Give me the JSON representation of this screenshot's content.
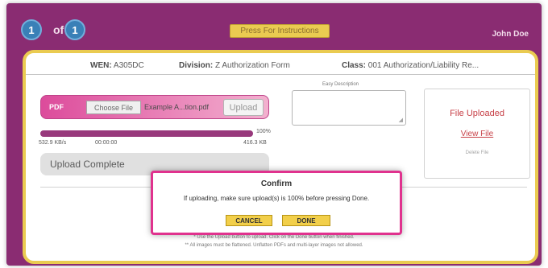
{
  "header": {
    "page_current": "1",
    "page_of": "of",
    "page_total": "1",
    "instructions_label": "Press For Instructions",
    "user_name": "John Doe"
  },
  "info_bar": {
    "wen_label": "WEN:",
    "wen_value": "A305DC",
    "division_label": "Division:",
    "division_value": "Z Authorization Form",
    "class_label": "Class:",
    "class_value": "001 Authorization/Liability Re..."
  },
  "upload": {
    "type_label": "PDF",
    "choose_label": "Choose File",
    "file_name": "Example A...tion.pdf",
    "upload_label": "Upload",
    "progress_percent": 100,
    "percent_text": "100%",
    "speed_text": "532.9 KB/s",
    "elapsed_text": "00:00:00",
    "size_text": "416.3 KB",
    "complete_text": "Upload Complete"
  },
  "description": {
    "label": "Easy Description"
  },
  "status": {
    "uploaded_text": "File Uploaded",
    "view_link": "View File",
    "delete_link": "Delete File"
  },
  "footer": {
    "note1": "* Use the Upload button to upload. Click on the Done button when finished.",
    "note2": "** All images must be flattened. Unflatten PDFs and multi-layer images not allowed."
  },
  "dialog": {
    "title": "Confirm",
    "message": "If uploading, make sure upload(s) is 100% before pressing Done.",
    "cancel_label": "CANCEL",
    "done_label": "DONE"
  },
  "colors": {
    "frame": "#7a0f5f",
    "accent_gold": "#e8c43a",
    "dialog_border": "#e0328e",
    "status_red": "#c0262e"
  }
}
